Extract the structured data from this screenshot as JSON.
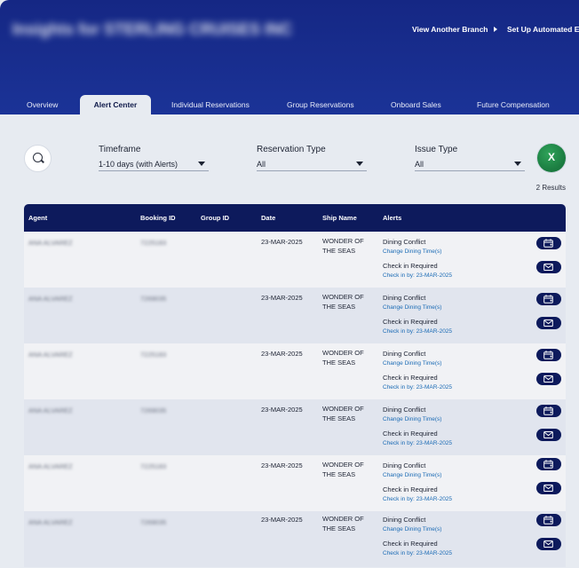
{
  "header": {
    "title": "Insights for STERLING CRUISES INC",
    "links": [
      "View Another Branch",
      "Set Up Automated E"
    ]
  },
  "tabs": [
    {
      "label": "Overview",
      "active": false
    },
    {
      "label": "Alert Center",
      "active": true
    },
    {
      "label": "Individual Reservations",
      "active": false
    },
    {
      "label": "Group Reservations",
      "active": false
    },
    {
      "label": "Onboard Sales",
      "active": false
    },
    {
      "label": "Future Compensation",
      "active": false
    }
  ],
  "filters": {
    "timeframe": {
      "label": "Timeframe",
      "value": "1-10 days (with Alerts)"
    },
    "reservation_type": {
      "label": "Reservation Type",
      "value": "All"
    },
    "issue_type": {
      "label": "Issue Type",
      "value": "All"
    }
  },
  "excel_label": "X",
  "results_text": "2 Results",
  "table": {
    "columns": [
      "Agent",
      "Booking ID",
      "Group ID",
      "Date",
      "Ship Name",
      "Alerts"
    ],
    "rows": [
      {
        "agent": "ANA ALVAREZ",
        "booking_id": "7225183",
        "group_id": "",
        "date": "23-MAR-2025",
        "ship": "WONDER OF THE SEAS",
        "alert1_title": "Dining Conflict",
        "alert1_link": "Change Dining Time(s)",
        "alert2_title": "Check in Required",
        "alert2_link": "Check in by: 23-MAR-2025"
      },
      {
        "agent": "ANA ALVAREZ",
        "booking_id": "7269035",
        "group_id": "",
        "date": "23-MAR-2025",
        "ship": "WONDER OF THE SEAS",
        "alert1_title": "Dining Conflict",
        "alert1_link": "Change Dining Time(s)",
        "alert2_title": "Check in Required",
        "alert2_link": "Check in by: 23-MAR-2025"
      },
      {
        "agent": "ANA ALVAREZ",
        "booking_id": "7225183",
        "group_id": "",
        "date": "23-MAR-2025",
        "ship": "WONDER OF THE SEAS",
        "alert1_title": "Dining Conflict",
        "alert1_link": "Change Dining Time(s)",
        "alert2_title": "Check in Required",
        "alert2_link": "Check in by: 23-MAR-2025"
      },
      {
        "agent": "ANA ALVAREZ",
        "booking_id": "7269035",
        "group_id": "",
        "date": "23-MAR-2025",
        "ship": "WONDER OF THE SEAS",
        "alert1_title": "Dining Conflict",
        "alert1_link": "Change Dining Time(s)",
        "alert2_title": "Check in Required",
        "alert2_link": "Check in by: 23-MAR-2025"
      },
      {
        "agent": "ANA ALVAREZ",
        "booking_id": "7225183",
        "group_id": "",
        "date": "23-MAR-2025",
        "ship": "WONDER OF THE SEAS",
        "alert1_title": "Dining Conflict",
        "alert1_link": "Change Dining Time(s)",
        "alert2_title": "Check in Required",
        "alert2_link": "Check in by: 23-MAR-2025"
      },
      {
        "agent": "ANA ALVAREZ",
        "booking_id": "7269035",
        "group_id": "",
        "date": "23-MAR-2025",
        "ship": "WONDER OF THE SEAS",
        "alert1_title": "Dining Conflict",
        "alert1_link": "Change Dining Time(s)",
        "alert2_title": "Check in Required",
        "alert2_link": "Check in by: 23-MAR-2025"
      }
    ]
  },
  "icons": {
    "search": "search-icon",
    "calendar": "calendar-icon",
    "mail": "mail-icon",
    "excel": "excel-icon"
  },
  "colors": {
    "header_bg": "#152784",
    "table_header_bg": "#0d1a5c",
    "link": "#1b6bb5",
    "excel_green": "#1a7a3f"
  }
}
